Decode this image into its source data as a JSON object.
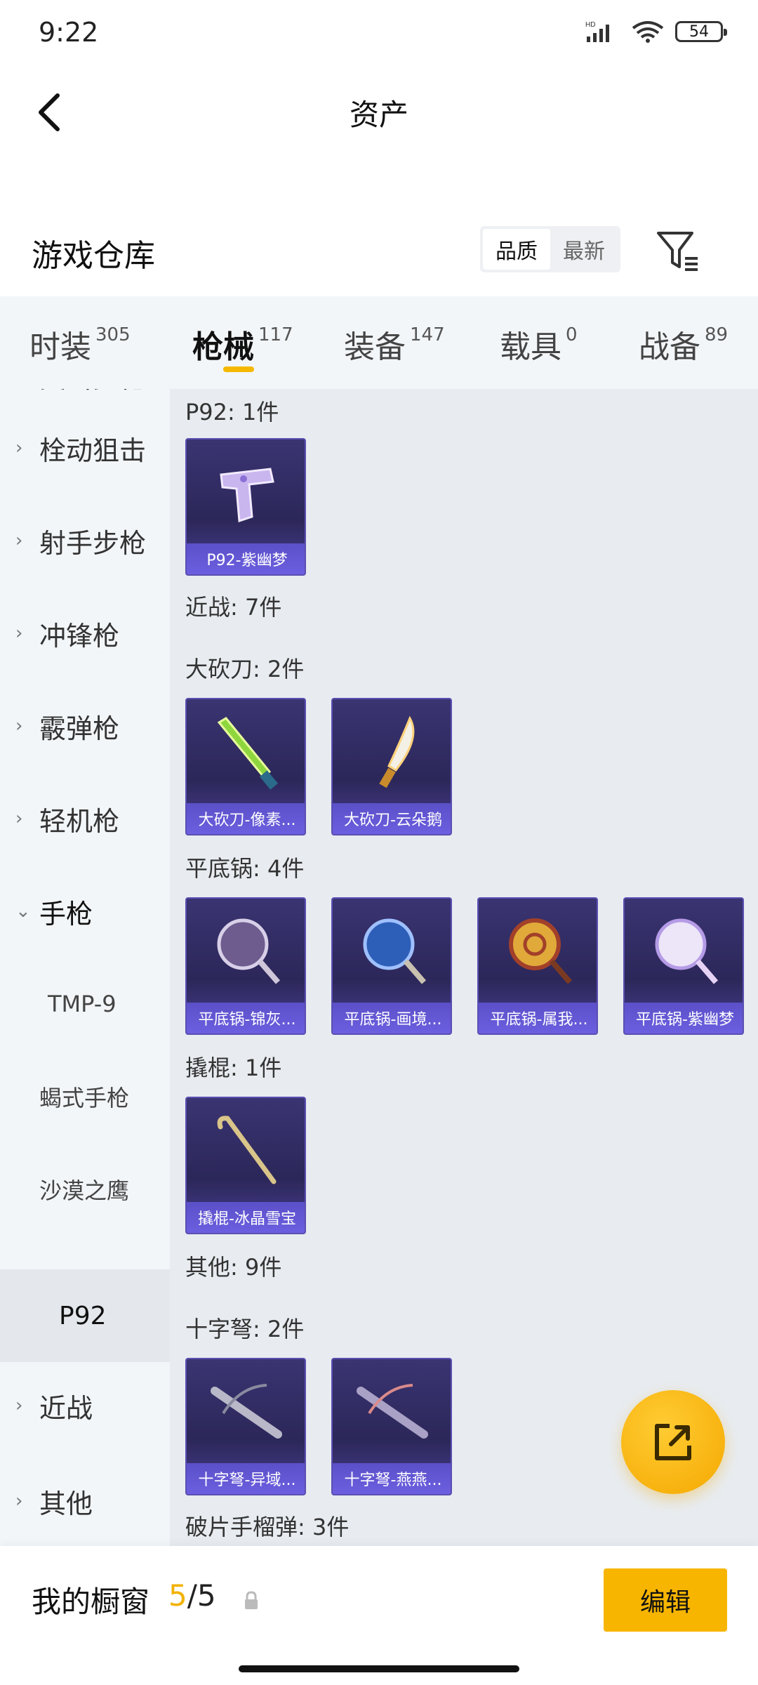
{
  "status": {
    "time": "9:22",
    "battery": "54",
    "network": "HD"
  },
  "header": {
    "title": "资产"
  },
  "warehouse": {
    "title": "游戏仓库",
    "sort_options": [
      "品质",
      "最新"
    ],
    "active_sort": "品质"
  },
  "tabs": [
    {
      "label": "时装",
      "count": "305"
    },
    {
      "label": "枪械",
      "count": "117",
      "active": true
    },
    {
      "label": "装备",
      "count": "147"
    },
    {
      "label": "载具",
      "count": "0"
    },
    {
      "label": "战备",
      "count": "89"
    }
  ],
  "sidebar": {
    "items": [
      {
        "label": "突击步枪"
      },
      {
        "label": "栓动狙击"
      },
      {
        "label": "射手步枪"
      },
      {
        "label": "冲锋枪"
      },
      {
        "label": "霰弹枪"
      },
      {
        "label": "轻机枪"
      },
      {
        "label": "手枪"
      },
      {
        "label": "TMP-9"
      },
      {
        "label": "蝎式手枪"
      },
      {
        "label": "沙漠之鹰"
      },
      {
        "label": "P92"
      },
      {
        "label": "近战"
      },
      {
        "label": "其他"
      }
    ]
  },
  "content": {
    "groups": [
      {
        "label": "P92: 1件",
        "cards": [
          "P92-紫幽梦"
        ]
      },
      {
        "label": "近战: 7件"
      },
      {
        "label": "大砍刀: 2件",
        "cards": [
          "大砍刀-像素...",
          "大砍刀-云朵鹅"
        ]
      },
      {
        "label": "平底锅: 4件",
        "cards": [
          "平底锅-锦灰...",
          "平底锅-画境...",
          "平底锅-属我...",
          "平底锅-紫幽梦"
        ]
      },
      {
        "label": "撬棍: 1件",
        "cards": [
          "撬棍-冰晶雪宝"
        ]
      },
      {
        "label": "其他: 9件"
      },
      {
        "label": "十字弩: 2件",
        "cards": [
          "十字弩-异域...",
          "十字弩-燕燕..."
        ]
      },
      {
        "label": "破片手榴弹: 3件"
      }
    ]
  },
  "bottom": {
    "window_title": "我的橱窗",
    "used": "5",
    "separator": "/",
    "total": "5",
    "edit_label": "编辑"
  }
}
